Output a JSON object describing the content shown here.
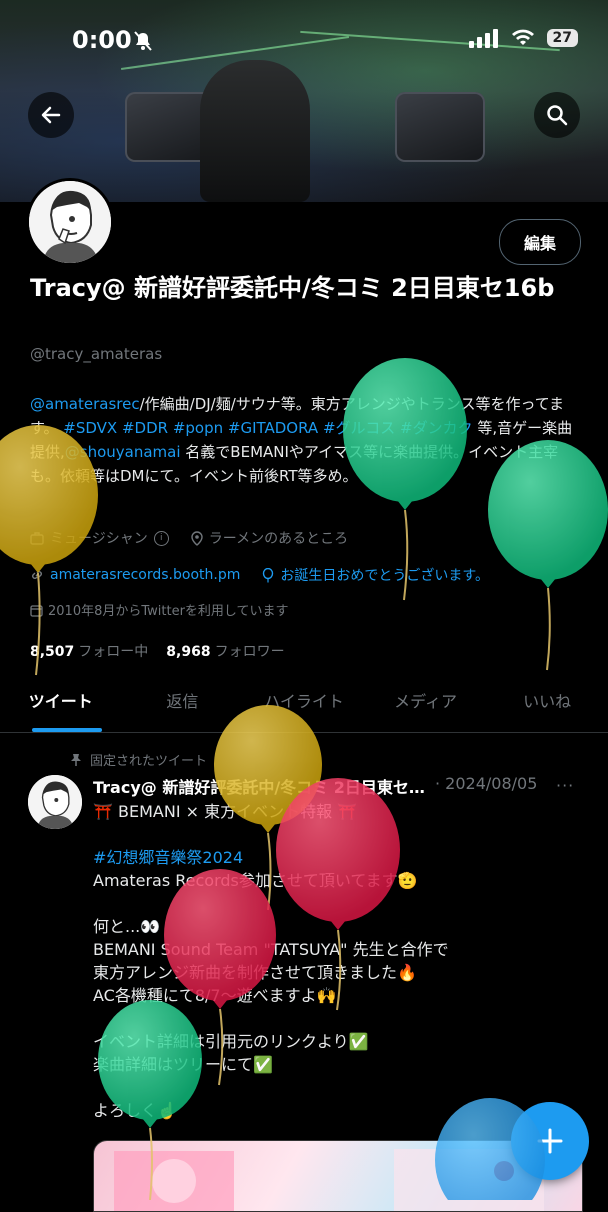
{
  "status_bar": {
    "time": "0:00",
    "battery": "27"
  },
  "profile": {
    "display_name": "Tracy@ 新譜好評委託中/冬コミ 2日目東セ16b",
    "handle": "@tracy_amateras",
    "edit_label": "編集",
    "bio": {
      "mention1": "@amaterasrec",
      "text1": "/作編曲/DJ/麺/サウナ等。東方アレンジやトランス等を作ってます。 ",
      "hashtags": "#SDVX #DDR #popn #GITADORA #グルコス #ダンカク",
      "text2": " 等,音ゲー楽曲提供,",
      "mention2": "@shouyanamai",
      "text3": " 名義でBEMANIやアイマス等に楽曲提供。イベント主宰も。依頼等はDMにて。イベント前後RT等多め。"
    },
    "category": "ミュージシャン",
    "location": "ラーメンのあるところ",
    "website": "amaterasrecords.booth.pm",
    "birthday": "お誕生日おめでとうございます。",
    "joined": "2010年8月からTwitterを利用しています",
    "following_count": "8,507",
    "following_label": "フォロー中",
    "followers_count": "8,968",
    "followers_label": "フォロワー"
  },
  "tabs": [
    {
      "label": "ツイート",
      "active": true
    },
    {
      "label": "返信",
      "active": false
    },
    {
      "label": "ハイライト",
      "active": false
    },
    {
      "label": "メディア",
      "active": false
    },
    {
      "label": "いいね",
      "active": false
    }
  ],
  "tweet": {
    "pinned_label": "固定されたツイート",
    "author": "Tracy@ 新譜好評委託中/冬コミ 2日目東セ16b",
    "date": "· 2024/08/05",
    "more": "···",
    "lines": {
      "l1": "⛩️ BEMANI × 東方イベント特報 ⛩️",
      "l2": "#幻想郷音樂祭2024",
      "l3": "Amateras Records参加させて頂いてます🫡",
      "l4": "何と...👀",
      "l5": "BEMANI Sound Team \"TATSUYA\" 先生と合作で",
      "l6": "東方アレンジ新曲を制作させて頂きました🔥",
      "l7": "AC各機種にて8/7〜遊べますよ🙌",
      "l8": "イベント詳細は引用元のリンクより✅",
      "l9": "楽曲詳細はツリーにて✅",
      "l10": "よろしく☝️"
    }
  },
  "colors": {
    "accent": "#1d9bf0",
    "background": "#000000",
    "muted": "#71767b"
  },
  "icons": [
    "back-arrow-icon",
    "search-icon",
    "briefcase-icon",
    "info-icon",
    "location-pin-icon",
    "link-icon",
    "balloon-icon",
    "calendar-icon",
    "pin-icon",
    "compose-plus-icon"
  ]
}
